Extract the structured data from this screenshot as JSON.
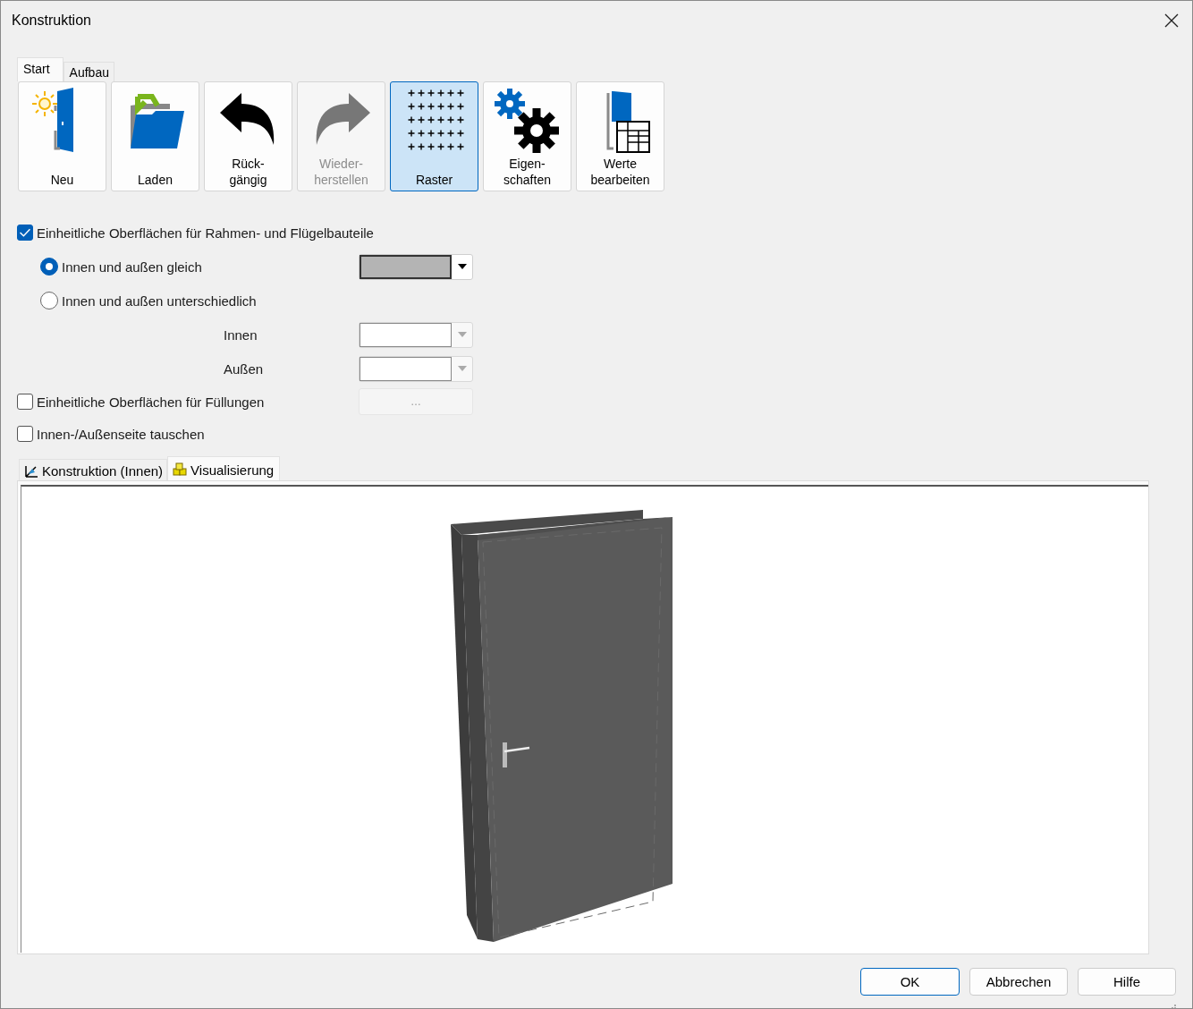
{
  "window": {
    "title": "Konstruktion"
  },
  "ribbon_tabs": [
    {
      "label": "Start",
      "selected": true
    },
    {
      "label": "Aufbau",
      "selected": false
    }
  ],
  "toolbar": [
    {
      "label": "Neu",
      "kind": "new",
      "disabled": false,
      "selected": false
    },
    {
      "label": "Laden",
      "kind": "open",
      "disabled": false,
      "selected": false
    },
    {
      "label": "Rück-\ngängig",
      "kind": "undo",
      "disabled": false,
      "selected": false
    },
    {
      "label": "Wieder-\nherstellen",
      "kind": "redo",
      "disabled": true,
      "selected": false
    },
    {
      "label": "Raster",
      "kind": "grid",
      "disabled": false,
      "selected": true
    },
    {
      "label": "Eigen-\nschaften",
      "kind": "properties",
      "disabled": false,
      "selected": false
    },
    {
      "label": "Werte\nbearbeiten",
      "kind": "table",
      "disabled": false,
      "selected": false
    }
  ],
  "surfaces": {
    "uniform_frame": {
      "label": "Einheitliche Oberflächen für Rahmen- und Flügelbauteile",
      "checked": true
    },
    "same": {
      "label": "Innen und außen gleich",
      "selected": true,
      "color": "#b4b4b4"
    },
    "different": {
      "label": "Innen und außen unterschiedlich",
      "selected": false
    },
    "inner": {
      "label": "Innen",
      "disabled": true
    },
    "outer": {
      "label": "Außen",
      "disabled": true
    },
    "uniform_fill": {
      "label": "Einheitliche Oberflächen für Füllungen",
      "checked": false,
      "button": "…",
      "disabled": true
    },
    "swap": {
      "label": "Innen-/Außenseite tauschen",
      "checked": false
    }
  },
  "view_tabs": [
    {
      "label": "Konstruktion (Innen)",
      "kind": "construction",
      "selected": false
    },
    {
      "label": "Visualisierung",
      "kind": "visualization",
      "selected": true
    }
  ],
  "buttons": [
    {
      "label": "OK",
      "default": true
    },
    {
      "label": "Abbrechen",
      "default": false
    },
    {
      "label": "Hilfe",
      "default": false
    }
  ]
}
